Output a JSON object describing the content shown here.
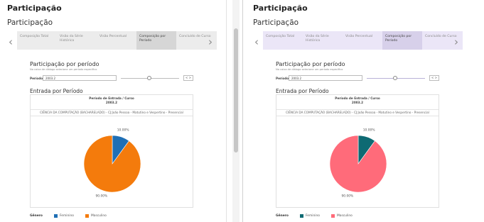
{
  "panels": [
    {
      "theme": "orange",
      "header": "Participação",
      "subheader": "Participação",
      "tabs": [
        "Composição Total",
        "Visão da Série Histórica",
        "Visão Percentual",
        "Composição por Período",
        "Concluído de Curso"
      ],
      "active_tab": 3,
      "section": {
        "title": "Participação por período",
        "subtitle": "Na caixa de diálogo selecione um período específico"
      },
      "filter": {
        "label": "Período",
        "value": "2003.2",
        "stepper": "< >"
      },
      "entrada_title": "Entrada por Período",
      "chart_title": "Período de Entrada / Curso",
      "chart_period": "2003.2",
      "course": "CIÊNCIA DA COMPUTAÇÃO (BACHARELADO) - CJ:João Pessoa - Matutino e Vespertino - Presencial",
      "colors": {
        "feminino": "#1f6fb5",
        "masculino": "#f47b0c"
      },
      "legend": {
        "label": "Gênero",
        "feminino": "Feminino",
        "masculino": "Masculino"
      },
      "chart_data": {
        "type": "pie",
        "categories": [
          "Feminino",
          "Masculino"
        ],
        "values": [
          10.0,
          90.0
        ],
        "labels": [
          "10.00%",
          "90.00%"
        ]
      }
    },
    {
      "theme": "pink",
      "header": "Participação",
      "subheader": "Participação",
      "tabs": [
        "Composição Total",
        "Visão da Série Histórica",
        "Visão Percentual",
        "Composição por Período",
        "Concluído de Curso"
      ],
      "active_tab": 3,
      "section": {
        "title": "Participação por período",
        "subtitle": "Na caixa de diálogo selecione um período específico"
      },
      "filter": {
        "label": "Período",
        "value": "2003.2",
        "stepper": "< >"
      },
      "entrada_title": "Entrada por Período",
      "chart_title": "Período de Entrada / Curso",
      "chart_period": "2003.2",
      "course": "CIÊNCIA DA COMPUTAÇÃO (BACHARELADO) - CJ:João Pessoa - Matutino e Vespertino - Presencial",
      "colors": {
        "feminino": "#0e6a73",
        "masculino": "#ff6b7a"
      },
      "legend": {
        "label": "Gênero",
        "feminino": "Feminino",
        "masculino": "Masculino"
      },
      "chart_data": {
        "type": "pie",
        "categories": [
          "Feminino",
          "Masculino"
        ],
        "values": [
          10.0,
          90.0
        ],
        "labels": [
          "10.00%",
          "90.00%"
        ]
      }
    }
  ],
  "theme_colors": {
    "orange": {
      "tab_bg": "#ececec",
      "tab_active_bg": "#d6d6d6",
      "filter_accent": "#bbbbbb"
    },
    "pink": {
      "tab_bg": "#ebe6f7",
      "tab_active_bg": "#d7d0ea",
      "filter_accent": "#b9b1d8"
    }
  }
}
